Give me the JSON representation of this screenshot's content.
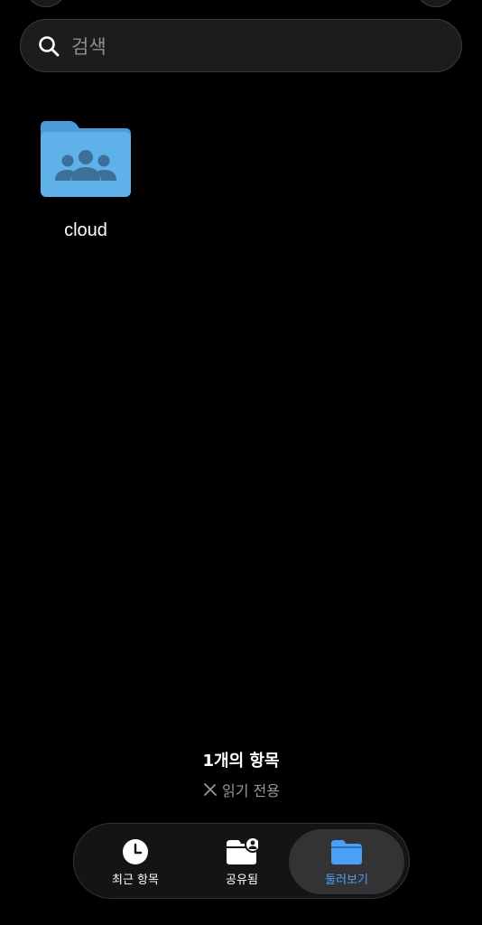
{
  "search": {
    "placeholder": "검색"
  },
  "items": [
    {
      "name": "cloud",
      "icon": "shared-folder-icon",
      "color": "#5fb1ea"
    }
  ],
  "status": {
    "count_text": "1개의 항목",
    "readonly_text": "읽기 전용",
    "readonly_icon": "pencil-slash-icon"
  },
  "tabs": [
    {
      "label": "최근 항목",
      "icon": "clock-icon",
      "active": false
    },
    {
      "label": "공유됨",
      "icon": "shared-folder-icon",
      "active": false
    },
    {
      "label": "둘러보기",
      "icon": "folder-icon",
      "active": true
    }
  ],
  "colors": {
    "accent": "#4aa0f5",
    "background": "#000000",
    "folder": "#5fb1ea"
  }
}
